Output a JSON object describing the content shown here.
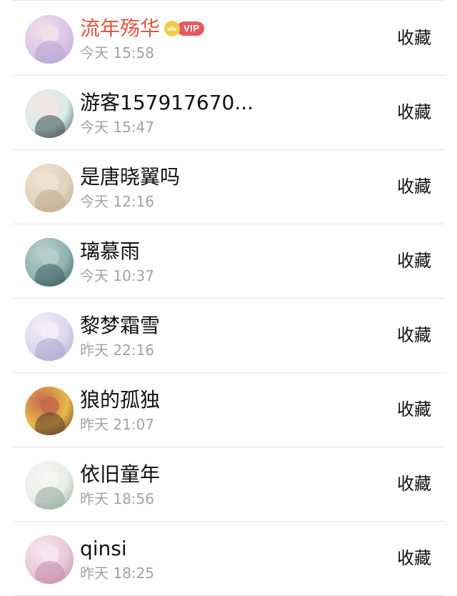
{
  "action_label": "收藏",
  "items": [
    {
      "name": "流年殇华",
      "time": "今天 15:58",
      "vip": true,
      "vip_label": "VIP",
      "avatar_colors": [
        "#d9c6e6",
        "#b7a4d0",
        "#f1dfe8"
      ]
    },
    {
      "name": "游客157917670...",
      "time": "今天 15:47",
      "vip": false,
      "avatar_colors": [
        "#d7ece9",
        "#3c4a52",
        "#f2e7df"
      ]
    },
    {
      "name": "是唐晓翼吗",
      "time": "今天 12:16",
      "vip": false,
      "avatar_colors": [
        "#e0d2bd",
        "#bfa98a",
        "#efe3d2"
      ]
    },
    {
      "name": "璃慕雨",
      "time": "今天 10:37",
      "vip": false,
      "avatar_colors": [
        "#8fb3b0",
        "#3d5d63",
        "#b9d0cc"
      ]
    },
    {
      "name": "黎梦霜雪",
      "time": "昨天 22:16",
      "vip": false,
      "avatar_colors": [
        "#dcd6ec",
        "#a7a6d2",
        "#f3eff9"
      ]
    },
    {
      "name": "狼的孤独",
      "time": "昨天 21:07",
      "vip": false,
      "avatar_colors": [
        "#e9b84a",
        "#5a3b2a",
        "#c46a4e"
      ]
    },
    {
      "name": "依旧童年",
      "time": "昨天 18:56",
      "vip": false,
      "avatar_colors": [
        "#e7efe7",
        "#8fa59a",
        "#f6f4f1"
      ]
    },
    {
      "name": "qinsi",
      "time": "昨天 18:25",
      "vip": false,
      "avatar_colors": [
        "#e8c9d8",
        "#c58aa8",
        "#f6e6ee"
      ]
    }
  ]
}
